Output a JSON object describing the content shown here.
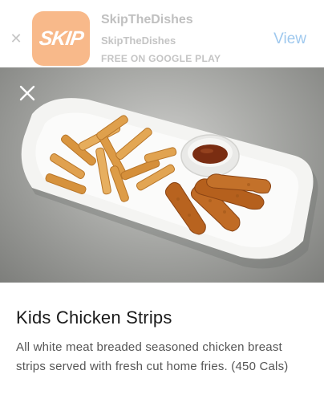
{
  "banner": {
    "close_icon": "close-icon",
    "app_icon_text": "SKIP",
    "app_name": "SkipTheDishes",
    "developer": "SkipTheDishes",
    "price_label": "FREE ON GOOGLE PLAY",
    "view_label": "View",
    "colors": {
      "app_icon_bg": "#f8b98a",
      "view": "#9ec8ee"
    }
  },
  "photo": {
    "close_icon": "close-icon",
    "subject": "plate-of-chicken-strips-and-fries"
  },
  "item": {
    "title": "Kids Chicken Strips",
    "description": "All white meat breaded seasoned chicken breast strips served with fresh cut home fries. (450 Cals)"
  }
}
